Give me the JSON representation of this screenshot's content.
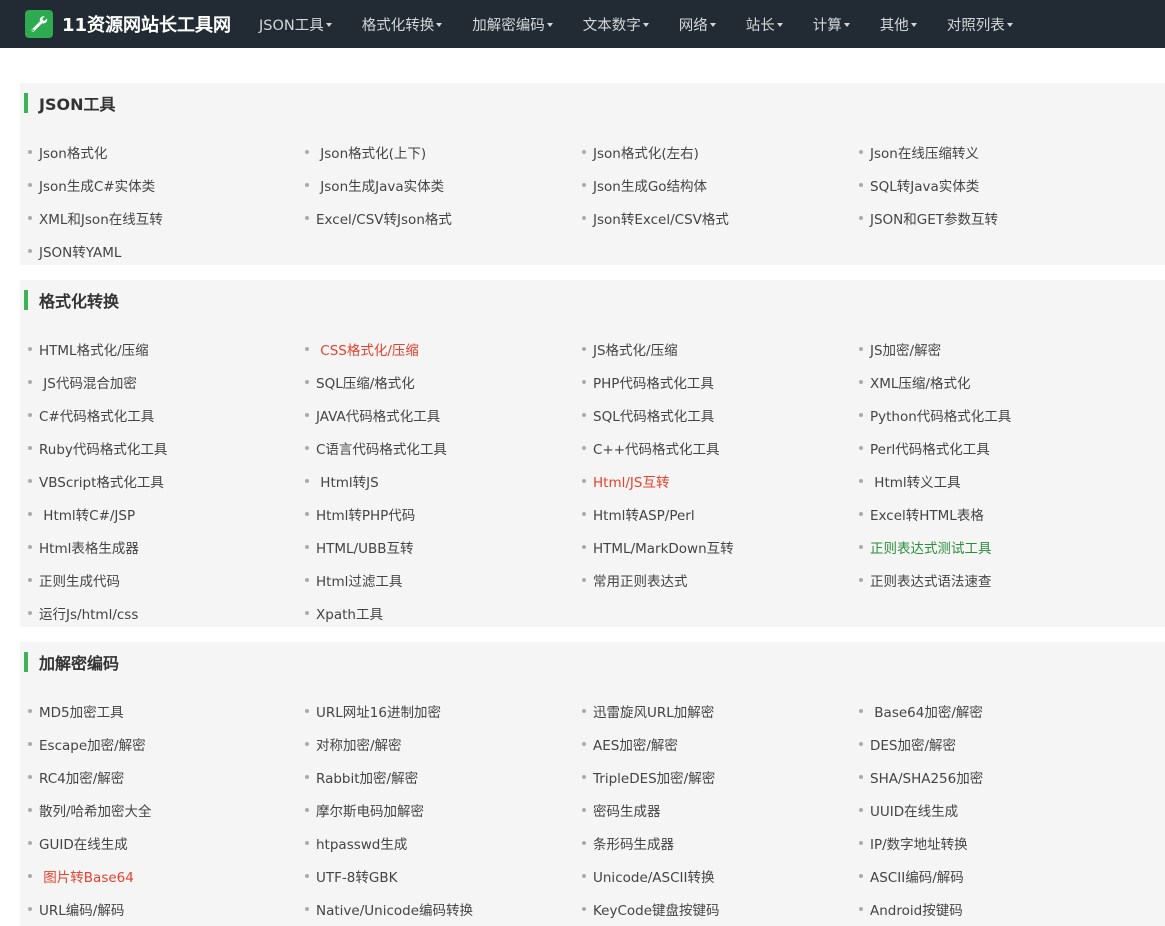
{
  "logo": {
    "text": "11资源网站长工具网",
    "icon": "wrench-icon",
    "icon_bg": "#2eaa4f"
  },
  "colors": {
    "topbar": "#222b33",
    "accent": "#3cb25a",
    "section_bg": "#f5f5f5",
    "highlight_red": "#e8412c",
    "highlight_green": "#2c8e3c"
  },
  "nav": [
    {
      "label": "JSON工具"
    },
    {
      "label": "格式化转换"
    },
    {
      "label": "加解密编码"
    },
    {
      "label": "文本数字"
    },
    {
      "label": "网络"
    },
    {
      "label": "站长"
    },
    {
      "label": "计算"
    },
    {
      "label": "其他"
    },
    {
      "label": "对照列表"
    }
  ],
  "sections": [
    {
      "title": "JSON工具",
      "items": [
        {
          "label": "Json格式化"
        },
        {
          "label": " Json格式化(上下)"
        },
        {
          "label": "Json格式化(左右)"
        },
        {
          "label": "Json在线压缩转义"
        },
        {
          "label": "Json生成C#实体类"
        },
        {
          "label": " Json生成Java实体类"
        },
        {
          "label": "Json生成Go结构体"
        },
        {
          "label": "SQL转Java实体类"
        },
        {
          "label": "XML和Json在线互转"
        },
        {
          "label": "Excel/CSV转Json格式"
        },
        {
          "label": "Json转Excel/CSV格式"
        },
        {
          "label": "JSON和GET参数互转"
        },
        {
          "label": "JSON转YAML"
        }
      ]
    },
    {
      "title": "格式化转换",
      "items": [
        {
          "label": "HTML格式化/压缩"
        },
        {
          "label": " CSS格式化/压缩",
          "color": "#e8412c"
        },
        {
          "label": "JS格式化/压缩"
        },
        {
          "label": "JS加密/解密"
        },
        {
          "label": " JS代码混合加密"
        },
        {
          "label": "SQL压缩/格式化"
        },
        {
          "label": "PHP代码格式化工具"
        },
        {
          "label": "XML压缩/格式化"
        },
        {
          "label": "C#代码格式化工具"
        },
        {
          "label": "JAVA代码格式化工具"
        },
        {
          "label": "SQL代码格式化工具"
        },
        {
          "label": "Python代码格式化工具"
        },
        {
          "label": "Ruby代码格式化工具"
        },
        {
          "label": "C语言代码格式化工具"
        },
        {
          "label": "C++代码格式化工具"
        },
        {
          "label": "Perl代码格式化工具"
        },
        {
          "label": "VBScript格式化工具"
        },
        {
          "label": " Html转JS"
        },
        {
          "label": "Html/JS互转",
          "color": "#e8412c"
        },
        {
          "label": " Html转义工具"
        },
        {
          "label": " Html转C#/JSP"
        },
        {
          "label": "Html转PHP代码"
        },
        {
          "label": "Html转ASP/Perl"
        },
        {
          "label": "Excel转HTML表格"
        },
        {
          "label": "Html表格生成器"
        },
        {
          "label": "HTML/UBB互转"
        },
        {
          "label": "HTML/MarkDown互转"
        },
        {
          "label": "正则表达式测试工具",
          "color": "#2c8e3c"
        },
        {
          "label": "正则生成代码"
        },
        {
          "label": "Html过滤工具"
        },
        {
          "label": "常用正则表达式"
        },
        {
          "label": "正则表达式语法速查"
        },
        {
          "label": "运行Js/html/css"
        },
        {
          "label": "Xpath工具"
        }
      ]
    },
    {
      "title": "加解密编码",
      "items": [
        {
          "label": "MD5加密工具"
        },
        {
          "label": "URL网址16进制加密"
        },
        {
          "label": "迅雷旋风URL加解密"
        },
        {
          "label": " Base64加密/解密"
        },
        {
          "label": "Escape加密/解密"
        },
        {
          "label": "对称加密/解密"
        },
        {
          "label": "AES加密/解密"
        },
        {
          "label": "DES加密/解密"
        },
        {
          "label": "RC4加密/解密"
        },
        {
          "label": "Rabbit加密/解密"
        },
        {
          "label": "TripleDES加密/解密"
        },
        {
          "label": "SHA/SHA256加密"
        },
        {
          "label": "散列/哈希加密大全"
        },
        {
          "label": "摩尔斯电码加解密"
        },
        {
          "label": "密码生成器"
        },
        {
          "label": "UUID在线生成"
        },
        {
          "label": "GUID在线生成"
        },
        {
          "label": "htpasswd生成"
        },
        {
          "label": "条形码生成器"
        },
        {
          "label": "IP/数字地址转换"
        },
        {
          "label": " 图片转Base64",
          "color": "#e8412c"
        },
        {
          "label": "UTF-8转GBK"
        },
        {
          "label": "Unicode/ASCII转换"
        },
        {
          "label": "ASCII编码/解码"
        },
        {
          "label": "URL编码/解码"
        },
        {
          "label": "Native/Unicode编码转换"
        },
        {
          "label": "KeyCode键盘按键码"
        },
        {
          "label": "Android按键码"
        }
      ]
    }
  ]
}
